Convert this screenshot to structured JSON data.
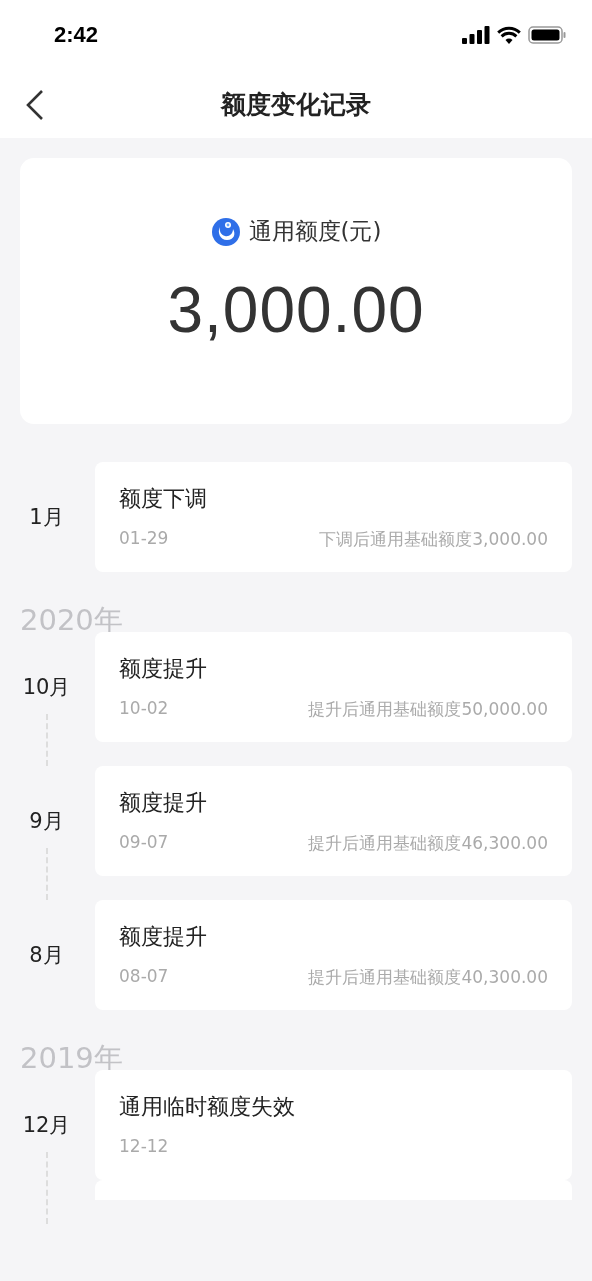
{
  "status_bar": {
    "time": "2:42"
  },
  "nav": {
    "title": "额度变化记录"
  },
  "summary": {
    "label": "通用额度(元)",
    "amount": "3,000.00"
  },
  "groups": [
    {
      "items": [
        {
          "month": "1月",
          "title": "额度下调",
          "date": "01-29",
          "detail": "下调后通用基础额度3,000.00",
          "line_below": false
        }
      ]
    },
    {
      "year": "2020年",
      "items": [
        {
          "month": "10月",
          "title": "额度提升",
          "date": "10-02",
          "detail": "提升后通用基础额度50,000.00",
          "line_below": true
        },
        {
          "month": "9月",
          "title": "额度提升",
          "date": "09-07",
          "detail": "提升后通用基础额度46,300.00",
          "line_below": true
        },
        {
          "month": "8月",
          "title": "额度提升",
          "date": "08-07",
          "detail": "提升后通用基础额度40,300.00",
          "line_below": false
        }
      ]
    },
    {
      "year": "2019年",
      "items": [
        {
          "month": "12月",
          "title": "通用临时额度失效",
          "date": "12-12",
          "line_below": true
        }
      ]
    }
  ]
}
